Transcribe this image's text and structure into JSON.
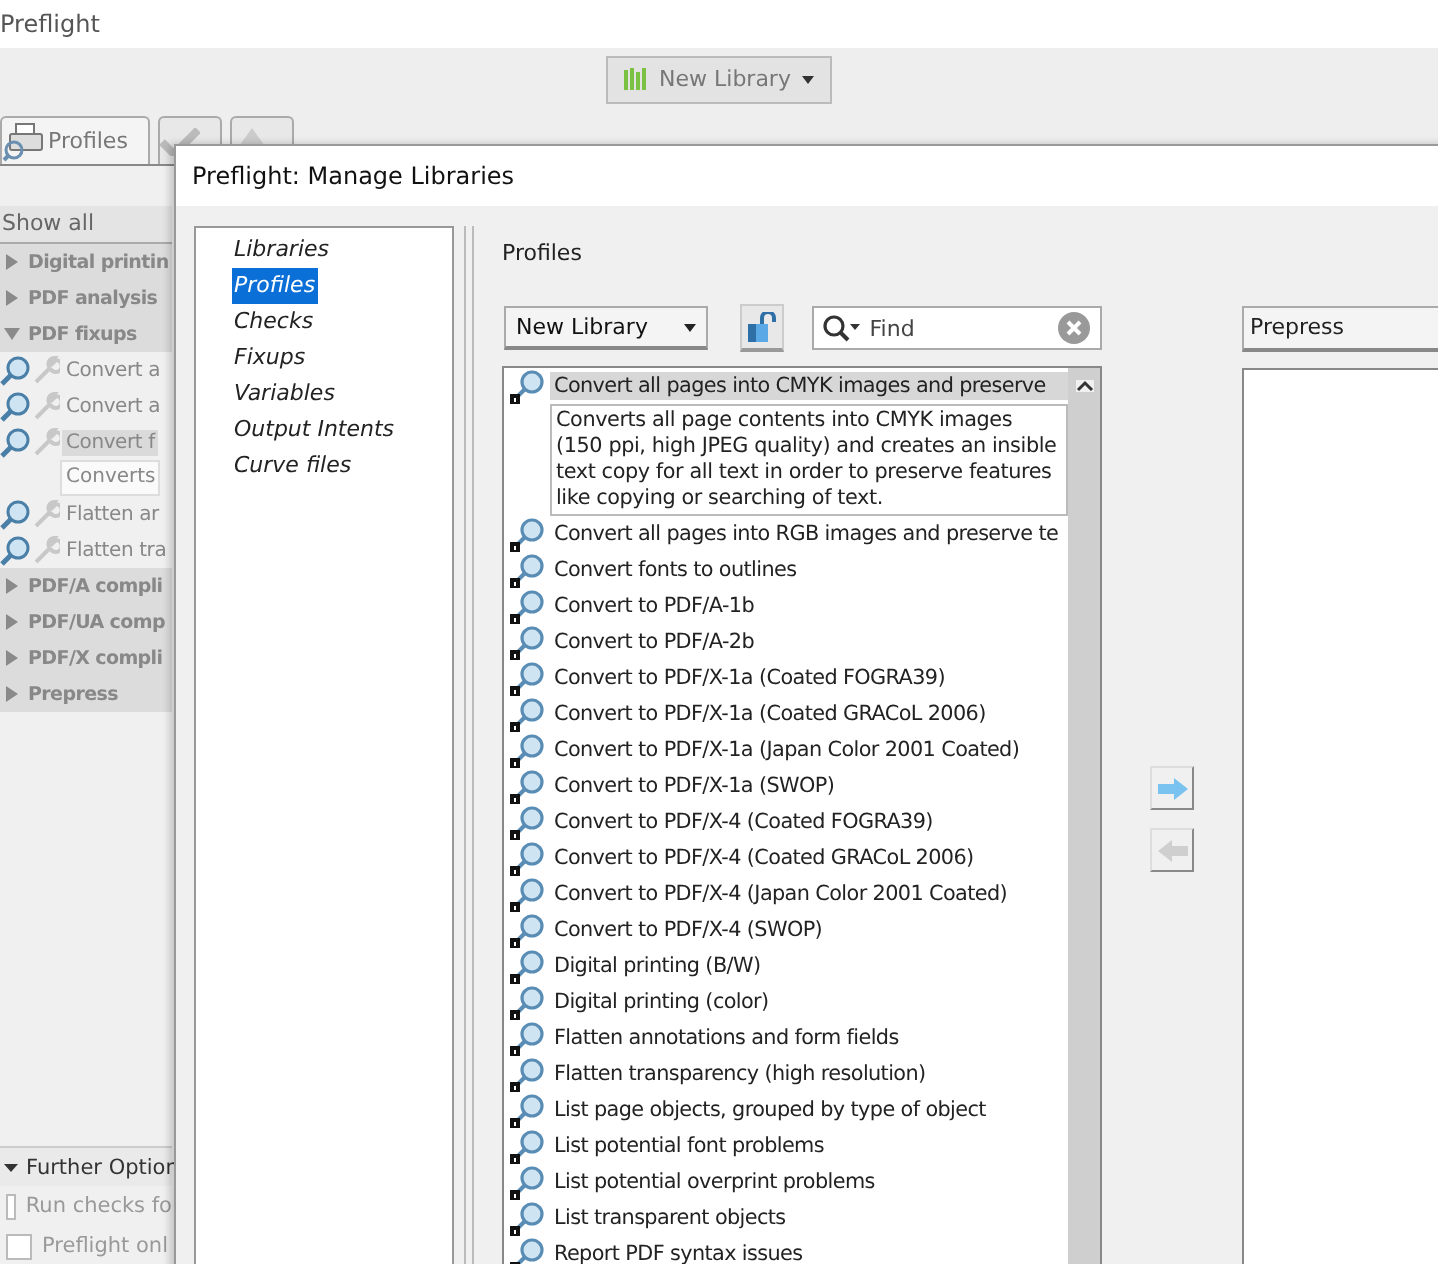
{
  "app": {
    "title": "Preflight",
    "toolbar_button": "New Library",
    "tabs": [
      {
        "label": "Profiles",
        "selected": true
      },
      {
        "selected": false
      },
      {
        "selected": false
      }
    ],
    "filter": "Show all",
    "tree": [
      {
        "label": "Digital printin",
        "expanded": false
      },
      {
        "label": "PDF analysis",
        "expanded": false
      },
      {
        "label": "PDF fixups",
        "expanded": true,
        "children": [
          {
            "label": "Convert a",
            "selected": false
          },
          {
            "label": "Convert a",
            "selected": false
          },
          {
            "label": "Convert f",
            "selected": true,
            "description": "Converts"
          },
          {
            "label": "Flatten ar",
            "selected": false
          },
          {
            "label": "Flatten tra",
            "selected": false
          }
        ]
      },
      {
        "label": "PDF/A compli",
        "expanded": false
      },
      {
        "label": "PDF/UA comp",
        "expanded": false
      },
      {
        "label": "PDF/X compli",
        "expanded": false
      },
      {
        "label": "Prepress",
        "expanded": false
      }
    ],
    "further_options": {
      "label": "Further Option",
      "expanded": true,
      "checkboxes": [
        {
          "label": "Run checks fo",
          "checked": false
        },
        {
          "label": "Preflight onl",
          "checked": false
        }
      ]
    }
  },
  "dialog": {
    "title": "Preflight: Manage Libraries",
    "nav": [
      {
        "label": "Libraries",
        "selected": false
      },
      {
        "label": "Profiles",
        "selected": true
      },
      {
        "label": "Checks",
        "selected": false
      },
      {
        "label": "Fixups",
        "selected": false
      },
      {
        "label": "Variables",
        "selected": false
      },
      {
        "label": "Output Intents",
        "selected": false
      },
      {
        "label": "Curve files",
        "selected": false
      }
    ],
    "heading": "Profiles",
    "library_dropdown": "New Library",
    "search": {
      "placeholder": "Find"
    },
    "target_dropdown": "Prepress",
    "profiles": [
      {
        "label": "Convert all pages into CMYK images and preserve",
        "selected": true,
        "description": "Converts all page contents into CMYK images (150 ppi, high JPEG quality) and creates an insible text copy for all text in order to preserve features like copying or searching of text."
      },
      {
        "label": "Convert all pages into RGB images and preserve te",
        "selected": false
      },
      {
        "label": "Convert fonts to outlines",
        "selected": false
      },
      {
        "label": "Convert to PDF/A-1b",
        "selected": false
      },
      {
        "label": "Convert to PDF/A-2b",
        "selected": false
      },
      {
        "label": "Convert to PDF/X-1a (Coated FOGRA39)",
        "selected": false
      },
      {
        "label": "Convert to PDF/X-1a (Coated GRACoL 2006)",
        "selected": false
      },
      {
        "label": "Convert to PDF/X-1a (Japan Color 2001 Coated)",
        "selected": false
      },
      {
        "label": "Convert to PDF/X-1a (SWOP)",
        "selected": false
      },
      {
        "label": "Convert to PDF/X-4 (Coated FOGRA39)",
        "selected": false
      },
      {
        "label": "Convert to PDF/X-4 (Coated GRACoL 2006)",
        "selected": false
      },
      {
        "label": "Convert to PDF/X-4 (Japan Color 2001 Coated)",
        "selected": false
      },
      {
        "label": "Convert to PDF/X-4 (SWOP)",
        "selected": false
      },
      {
        "label": "Digital printing (B/W)",
        "selected": false
      },
      {
        "label": "Digital printing (color)",
        "selected": false
      },
      {
        "label": "Flatten annotations and form fields",
        "selected": false
      },
      {
        "label": "Flatten transparency (high resolution)",
        "selected": false
      },
      {
        "label": "List page objects, grouped by type of object",
        "selected": false
      },
      {
        "label": "List potential font problems",
        "selected": false
      },
      {
        "label": "List potential overprint problems",
        "selected": false
      },
      {
        "label": "List transparent objects",
        "selected": false
      },
      {
        "label": "Report PDF syntax issues",
        "selected": false
      }
    ]
  }
}
